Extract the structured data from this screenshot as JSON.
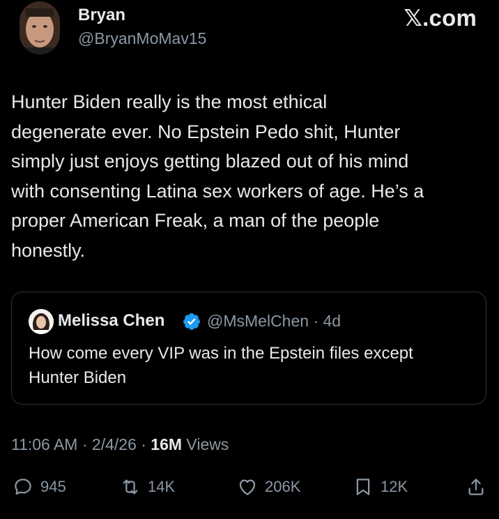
{
  "author": {
    "display_name": "Bryan",
    "handle": "@BryanMoMav15"
  },
  "site_logo": "𝕏.com",
  "tweet_text": "Hunter Biden really is the most ethical\ndegenerate ever. No Epstein Pedo shit, Hunter\nsimply just enjoys getting blazed out of his mind\nwith consenting Latina sex workers of age. He’s a\nproper American Freak, a man of the people\nhonestly.",
  "quoted_tweet": {
    "display_name": "Melissa Chen",
    "handle_time": "@MsMelChen · 4d",
    "text": "How come every VIP was in the Epstein files except\nHunter Biden"
  },
  "meta": {
    "timestamp": "11:06 AM · 2/4/26 · ",
    "views_count": "16M",
    "views_label": " Views"
  },
  "actions": {
    "replies": "945",
    "reposts": "14K",
    "likes": "206K",
    "bookmarks": "12K"
  },
  "colors": {
    "background": "#000000",
    "text": "#e7e9ea",
    "secondary": "#8b98a5",
    "verified": "#1d9bf0"
  }
}
